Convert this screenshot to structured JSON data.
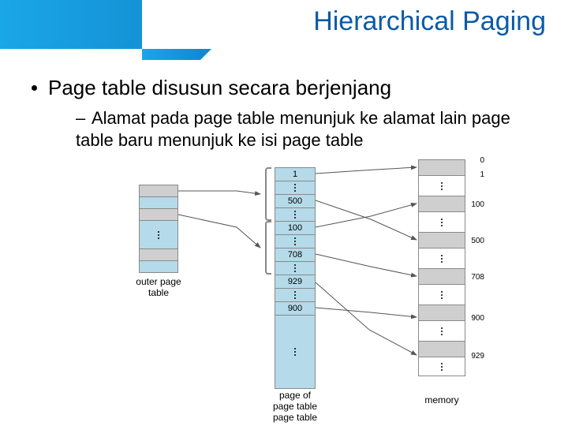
{
  "header": {
    "title": "Hierarchical Paging"
  },
  "body": {
    "bullet": "Page table disusun secara berjenjang",
    "sub": "Alamat pada page table menunjuk ke alamat lain page table baru menunjuk ke isi page table"
  },
  "diagram": {
    "captions": {
      "outer": "outer page\ntable",
      "mid_top": "page of\npage table",
      "mid_bottom": "page table",
      "right": "memory"
    },
    "mid_cells": [
      "1",
      "",
      "500",
      "",
      "100",
      "",
      "708",
      "",
      "929",
      "",
      "900"
    ],
    "memory_cells_color": [
      "grey",
      "",
      "grey",
      "",
      "grey",
      "",
      "grey",
      "",
      "grey",
      "",
      "grey",
      "",
      "grey",
      ""
    ],
    "memory_numbers": [
      "0",
      "1",
      "100",
      "500",
      "708",
      "900",
      "929"
    ]
  }
}
